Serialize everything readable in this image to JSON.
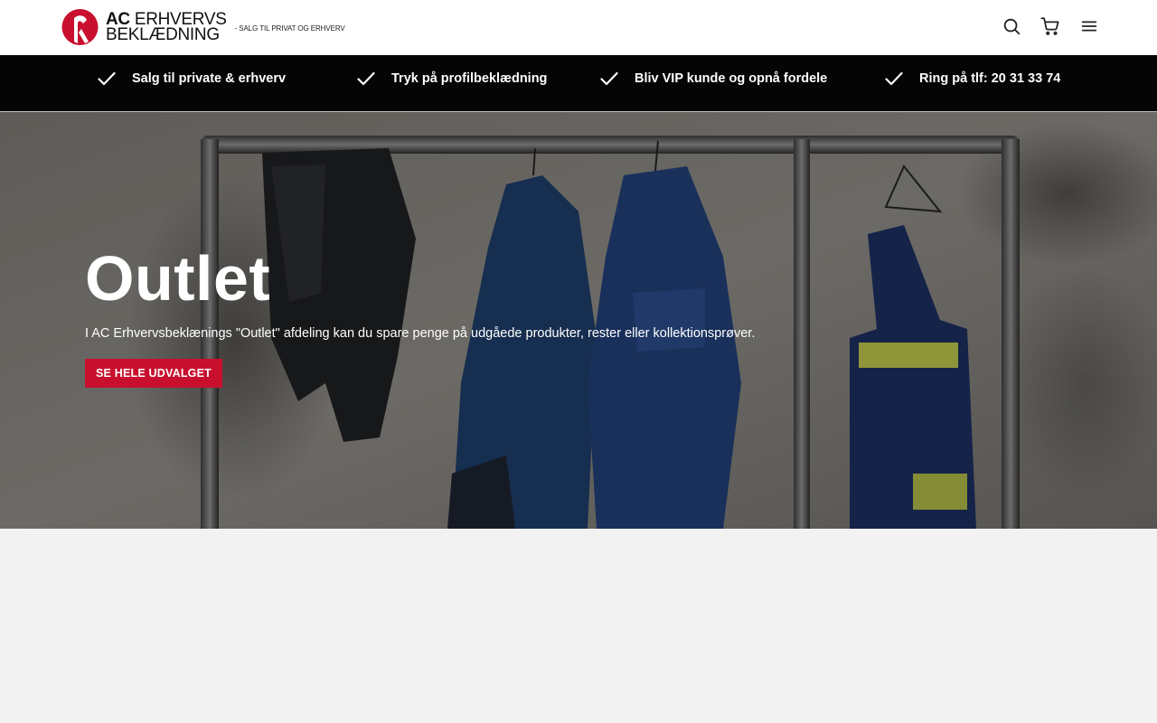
{
  "header": {
    "logo": {
      "brand_bold": "AC",
      "brand_line1": "ERHVERVS",
      "brand_line2": "BEKLÆDNING",
      "tagline": "- SALG TIL PRIVAT OG ERHVERV",
      "mark_color": "#c8102e"
    },
    "icons": [
      "search-icon",
      "cart-icon",
      "menu-icon"
    ]
  },
  "usp_bar": {
    "items": [
      {
        "icon": "checkmark-icon",
        "label": "Salg til private & erhverv"
      },
      {
        "icon": "checkmark-icon",
        "label": "Tryk på profilbeklædning"
      },
      {
        "icon": "checkmark-icon",
        "label": "Bliv VIP kunde og opnå fordele"
      },
      {
        "icon": "checkmark-icon",
        "label": "Ring på tlf: 20 31 33 74"
      }
    ]
  },
  "hero": {
    "title": "Outlet",
    "subtitle": "I AC Erhvervsbeklænings \"Outlet\" afdeling kan du spare penge på udgåede produkter, rester eller kollektionsprøver.",
    "button_label": "SE HELE UDVALGET",
    "button_color": "#c8102e"
  },
  "colors": {
    "accent": "#c8102e",
    "usp_background": "#050505",
    "page_background": "#f2f2f2"
  }
}
